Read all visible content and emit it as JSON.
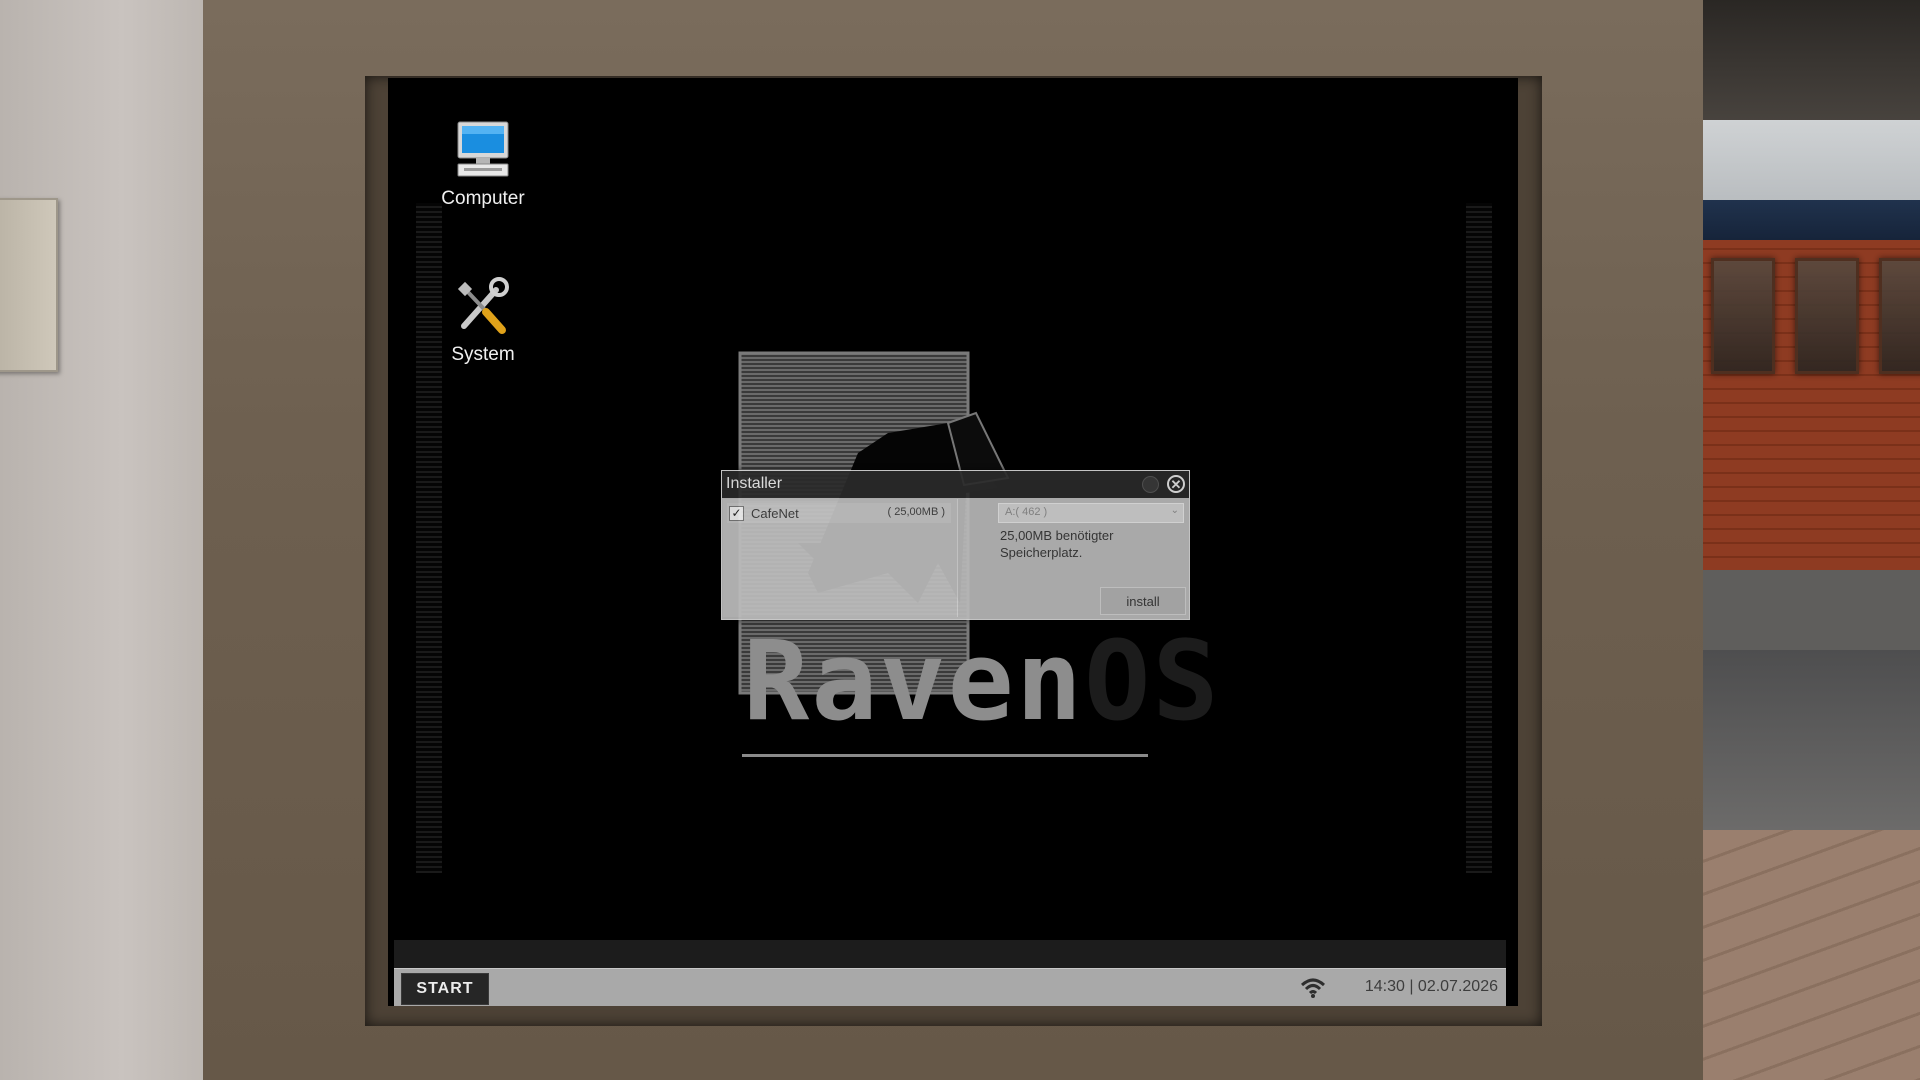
{
  "desktop": {
    "icons": [
      {
        "label": "Computer",
        "icon": "computer-icon"
      },
      {
        "label": "System",
        "icon": "tools-icon"
      }
    ],
    "logo": {
      "part1": "Raven",
      "part2": "OS"
    }
  },
  "installer": {
    "title": "Installer",
    "items": [
      {
        "name": "CafeNet",
        "size": "( 25,00MB )",
        "checked": true
      }
    ],
    "drive": "A:( 462 )",
    "requirement": "25,00MB benötigter Speicherplatz.",
    "install_label": "install"
  },
  "taskbar": {
    "start_label": "START",
    "clock": "14:30 | 02.07.2026",
    "wifi_icon": "wifi-icon"
  },
  "colors": {
    "screen_bg": "#000000",
    "taskbar": "#a9a9a9",
    "window_title": "#2a2a2a"
  }
}
